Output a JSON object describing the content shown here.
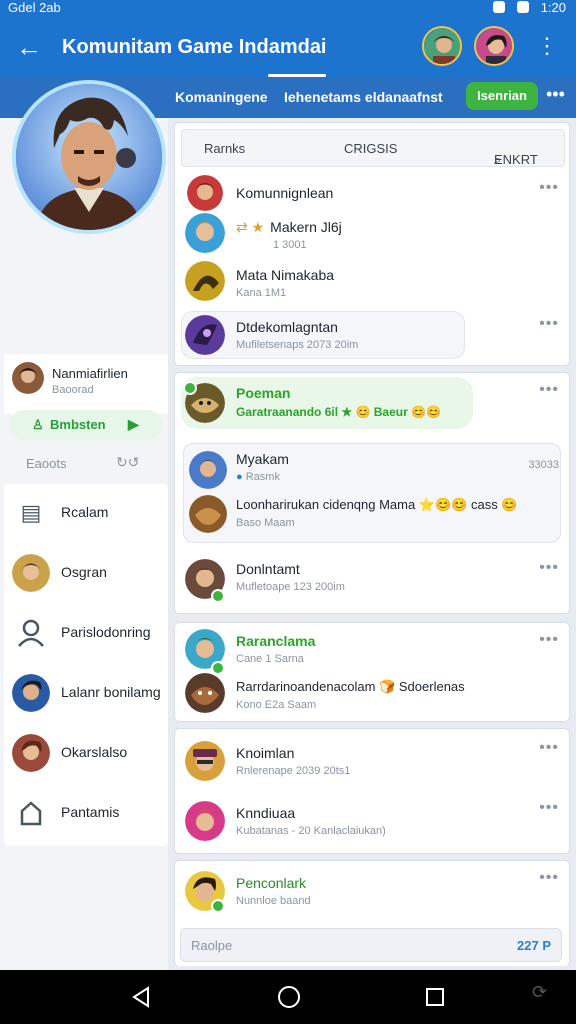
{
  "status": {
    "left": "Gdel 2ab",
    "time": "1:20"
  },
  "app": {
    "title": "Komunitam Game Indamdai"
  },
  "subbar": {
    "tabs": [
      "Komaningene",
      "Iehenetams eldanaafnst"
    ],
    "join": "Isenrian"
  },
  "left": {
    "profile": {
      "name": "Nanmiafirlien",
      "sub": "Baoorad"
    },
    "follow_label": "Bmbsten",
    "section_label": "Eaoots",
    "menu": [
      {
        "label": "Rcalam",
        "icon": "document-icon"
      },
      {
        "label": "Osgran",
        "icon": "avatar-icon"
      },
      {
        "label": "Parislodonring",
        "icon": "user-icon"
      },
      {
        "label": "Lalanr bonilamg",
        "icon": "avatar-icon"
      },
      {
        "label": "Okarslalso",
        "icon": "avatar-icon"
      },
      {
        "label": "Pantamis",
        "icon": "home-icon"
      }
    ]
  },
  "filters": {
    "a": "Rarnks",
    "b": "CRIGSIS",
    "c": "ENKRT"
  },
  "card1": [
    {
      "title": "Komunnignlean",
      "sub": ""
    },
    {
      "title": "Makern Jl6j",
      "sub": "1 3001",
      "prefix": "⇄ ★"
    },
    {
      "title": "Mata Nimakaba",
      "sub": "Kana 1M1"
    },
    {
      "title": "Dtdekomlagntan",
      "sub": "Mufiletsenaps 2073 20im"
    }
  ],
  "card2": {
    "green": {
      "title": "Poeman",
      "sub": "Garatraanando 6il ★ 😊 Baeur 😊😊"
    },
    "mid": {
      "title": "Myakam",
      "sub": "Rasmk",
      "date": "33033"
    },
    "mid2": {
      "title": "Loonharirukan cidenqng Mama ⭐😊😊 cass 😊",
      "sub": "Baso Maam"
    },
    "last": {
      "title": "Donlntamt",
      "sub": "Mufletoape 123 200im"
    }
  },
  "card3": [
    {
      "title": "Raranclama",
      "sub": "Cane 1 Sarna"
    },
    {
      "title": "Rarrdarinoandenacolam 🍞 Sdoerlenas",
      "sub": "Kono E2a Saam"
    }
  ],
  "card4": [
    {
      "title": "Knoimlan",
      "sub": "Rnlerenape 2039 20ts1"
    },
    {
      "title": "Knndiuaa",
      "sub": "Kubatanas - 20 Kanlaclaiukan)"
    }
  ],
  "card5": {
    "title": "Penconlark",
    "sub": "Nunnloe baand",
    "input_placeholder": "Raolpe",
    "input_right": "227 P"
  },
  "menu_dots": "•••",
  "colors": {
    "appbar": "#1d74cf",
    "accent_green": "#3fb33f"
  }
}
